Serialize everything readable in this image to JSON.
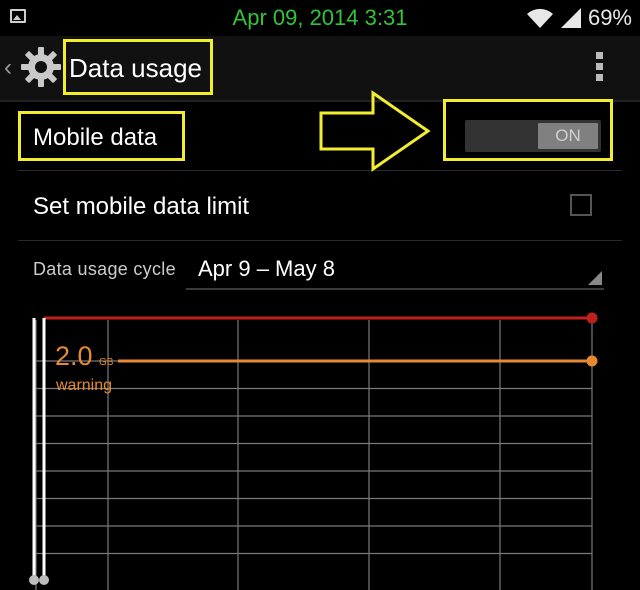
{
  "status_bar": {
    "time": "Apr 09, 2014 3:31",
    "battery": "69%",
    "icons": [
      "gallery-icon",
      "wifi-icon",
      "signal-icon"
    ]
  },
  "action_bar": {
    "title": "Data usage",
    "icons": [
      "back-chevron-icon",
      "settings-gear-icon",
      "overflow-menu-icon"
    ]
  },
  "mobile_data": {
    "label": "Mobile data",
    "toggle_label": "ON",
    "enabled": true
  },
  "data_limit": {
    "label": "Set mobile data limit",
    "checked": false
  },
  "cycle": {
    "label": "Data usage cycle",
    "value": "Apr 9 – May 8"
  },
  "warning": {
    "value": "2.0",
    "unit": "GB",
    "label": "warning"
  },
  "colors": {
    "status_time": "#33c33b",
    "highlight": "#f2ee2e",
    "limit_line": "#c0201c",
    "warning_line": "#e68a32",
    "grid": "#7a7a7a"
  }
}
